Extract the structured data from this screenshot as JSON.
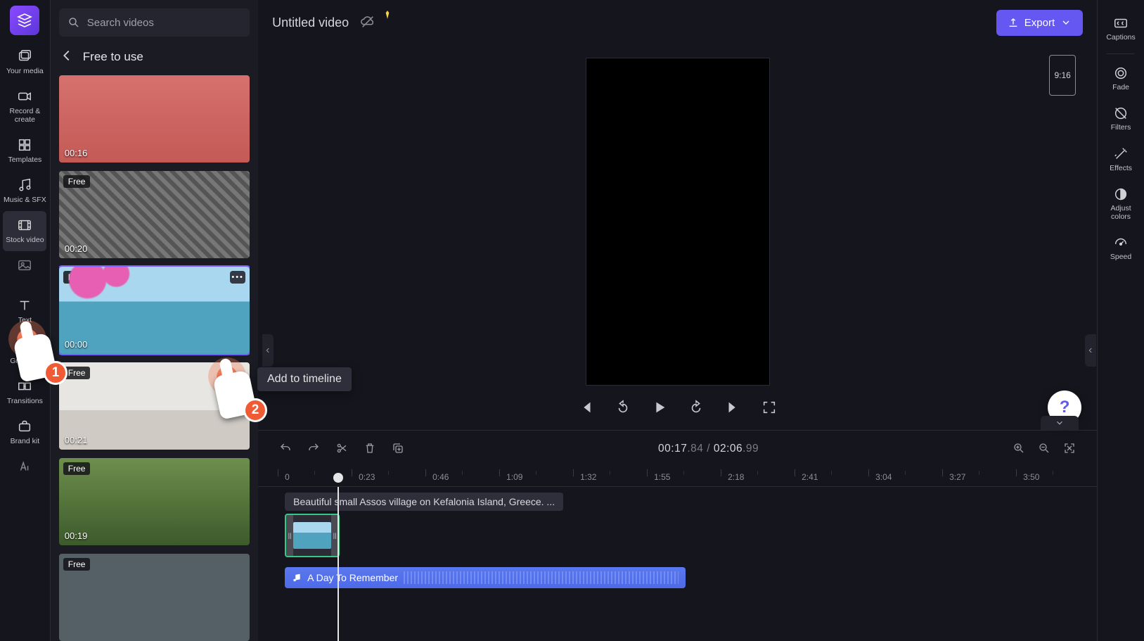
{
  "app": {
    "logo_color_a": "#8a4bff",
    "logo_color_b": "#5c36d9"
  },
  "sidebar": {
    "items": [
      {
        "label": "Your media",
        "icon": "image-stack-icon"
      },
      {
        "label": "Record &\ncreate",
        "icon": "camera-icon"
      },
      {
        "label": "Templates",
        "icon": "templates-icon"
      },
      {
        "label": "Music & SFX",
        "icon": "music-icon"
      },
      {
        "label": "Stock video",
        "icon": "film-icon",
        "active": true
      },
      {
        "label": "Stock images",
        "icon": "image-icon"
      },
      {
        "label": "Text",
        "icon": "text-icon"
      },
      {
        "label": "Graphics",
        "icon": "shapes-icon"
      },
      {
        "label": "Transitions",
        "icon": "transitions-icon"
      },
      {
        "label": "Brand kit",
        "icon": "briefcase-icon"
      }
    ]
  },
  "mediaPanel": {
    "search_placeholder": "Search videos",
    "header": "Free to use",
    "thumbs": [
      {
        "duration": "00:16",
        "free": false,
        "style": "bg-woman"
      },
      {
        "duration": "00:20",
        "free": true,
        "style": "bg-static"
      },
      {
        "duration": "00:00",
        "free": true,
        "style": "bg-assos",
        "selected": true,
        "more": true
      },
      {
        "duration": "00:21",
        "free": true,
        "style": "bg-room"
      },
      {
        "duration": "00:19",
        "free": true,
        "style": "bg-field"
      },
      {
        "duration": "",
        "free": true,
        "style": "bg-extra"
      }
    ]
  },
  "project": {
    "title": "Untitled video",
    "sync_status": "offline",
    "premium": true
  },
  "export": {
    "label": "Export"
  },
  "preview": {
    "aspect_label": "9:16"
  },
  "timeline": {
    "current": "00:17",
    "current_frac": ".84",
    "sep": " / ",
    "total": "02:06",
    "total_frac": ".99",
    "ruler": [
      "0",
      "0:23",
      "0:46",
      "1:09",
      "1:32",
      "1:55",
      "2:18",
      "2:41",
      "3:04",
      "3:27",
      "3:50"
    ],
    "clip_tooltip": "Beautiful small Assos village on Kefalonia Island, Greece. ...",
    "audio_clip_label": "A Day To Remember"
  },
  "rightbar": {
    "items": [
      {
        "label": "Captions",
        "icon": "cc-icon"
      },
      {
        "label": "Fade",
        "icon": "fade-icon"
      },
      {
        "label": "Filters",
        "icon": "filters-icon"
      },
      {
        "label": "Effects",
        "icon": "wand-icon"
      },
      {
        "label": "Adjust\ncolors",
        "icon": "contrast-icon"
      },
      {
        "label": "Speed",
        "icon": "speed-icon"
      }
    ]
  },
  "tutorial": {
    "pointer1_num": "1",
    "pointer2_num": "2",
    "add_tooltip": "Add to timeline"
  },
  "help": {
    "symbol": "?"
  }
}
